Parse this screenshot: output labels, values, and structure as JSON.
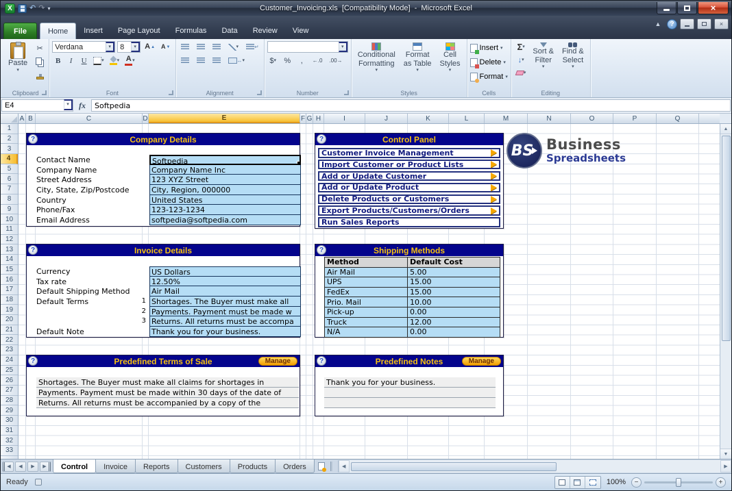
{
  "titlebar": {
    "title": "Customer_Invoicing.xls  [Compatibility Mode]  -  Microsoft Excel"
  },
  "icons": {
    "excel": "X",
    "undo": "↶",
    "redo": "↷",
    "caret": "▾",
    "help": "?",
    "close": "×",
    "up": "▲",
    "down": "▼",
    "left": "◀",
    "right": "▶",
    "grow": "▲",
    "shrink": "▼",
    "wrap_return": "↵",
    "merge_arrows": "↔",
    "fill_arrow": "↓"
  },
  "ribbon_tabs": {
    "file": "File",
    "tabs": [
      "Home",
      "Insert",
      "Page Layout",
      "Formulas",
      "Data",
      "Review",
      "View"
    ],
    "active": "Home"
  },
  "ribbon": {
    "clipboard": {
      "label": "Clipboard",
      "paste": "Paste",
      "cut": "✂"
    },
    "font": {
      "label": "Font",
      "name": "Verdana",
      "size": "8",
      "bold": "B",
      "italic": "I",
      "underline": "U",
      "letter": "A"
    },
    "alignment": {
      "label": "Alignment"
    },
    "number": {
      "label": "Number",
      "format": "",
      "currency": "$",
      "percent": "%",
      "comma": ",",
      "inc_dec": "←.0",
      "dec_dec": ".00→"
    },
    "styles": {
      "label": "Styles",
      "cond1": "Conditional",
      "cond2": "Formatting",
      "tbl1": "Format",
      "tbl2": "as Table",
      "cs1": "Cell",
      "cs2": "Styles"
    },
    "cells": {
      "label": "Cells",
      "insert": "Insert",
      "del": "Delete",
      "format": "Format"
    },
    "editing": {
      "label": "Editing",
      "autosum": "Σ",
      "sf1": "Sort &",
      "sf2": "Filter",
      "fs1": "Find &",
      "fs2": "Select"
    }
  },
  "formula_bar": {
    "name_box": "E4",
    "fx": "fx",
    "value": "Softpedia"
  },
  "grid": {
    "columns": [
      "A",
      "B",
      "C",
      "D",
      "E",
      "F",
      "G",
      "H",
      "I",
      "J",
      "K",
      "L",
      "M",
      "N",
      "O",
      "P",
      "Q"
    ],
    "selected_column": "E",
    "row_count": 33,
    "selected_row": 4
  },
  "panels": {
    "company": {
      "title": "Company Details",
      "fields": [
        {
          "label": "Contact Name",
          "value": "Softpedia",
          "selected": true
        },
        {
          "label": "Company Name",
          "value": "Company Name Inc"
        },
        {
          "label": "Street Address",
          "value": "123 XYZ Street"
        },
        {
          "label": "City, State, Zip/Postcode",
          "value": "City, Region, 000000"
        },
        {
          "label": "Country",
          "value": "United States"
        },
        {
          "label": "Phone/Fax",
          "value": "123-123-1234"
        },
        {
          "label": "Email Address",
          "value": "softpedia@softpedia.com"
        }
      ]
    },
    "control": {
      "title": "Control Panel",
      "buttons": [
        {
          "label": "Customer Invoice Management",
          "arrow": true
        },
        {
          "label": "Import Customer or Product Lists",
          "arrow": true
        },
        {
          "label": "Add or Update Customer",
          "arrow": true
        },
        {
          "label": "Add or Update Product",
          "arrow": true
        },
        {
          "label": "Delete Products or Customers",
          "arrow": true
        },
        {
          "label": "Export Products/Customers/Orders",
          "arrow": true
        },
        {
          "label": "Run Sales Reports",
          "arrow": false
        }
      ]
    },
    "invoice": {
      "title": "Invoice Details",
      "rows": [
        {
          "label": "Currency",
          "value": "US Dollars"
        },
        {
          "label": "Tax rate",
          "value": "12.50%"
        },
        {
          "label": "Default Shipping Method",
          "value": "Air Mail"
        },
        {
          "label": "Default Terms",
          "num": "1",
          "value": "Shortages. The Buyer must make all"
        },
        {
          "label": "",
          "num": "2",
          "value": "Payments. Payment must be made w"
        },
        {
          "label": "",
          "num": "3",
          "value": "Returns. All returns must be accompa"
        },
        {
          "label": "Default Note",
          "value": "Thank you for your business."
        }
      ]
    },
    "shipping": {
      "title": "Shipping Methods",
      "col1": "Method",
      "col2": "Default Cost",
      "rows": [
        [
          "Air Mail",
          "5.00"
        ],
        [
          "UPS",
          "15.00"
        ],
        [
          "FedEx",
          "15.00"
        ],
        [
          "Prio. Mail",
          "10.00"
        ],
        [
          "Pick-up",
          "0.00"
        ],
        [
          "Truck",
          "12.00"
        ],
        [
          "N/A",
          "0.00"
        ]
      ]
    },
    "terms": {
      "title": "Predefined Terms of Sale",
      "manage": "Manage",
      "lines": [
        "Shortages. The Buyer must make all claims for shortages in",
        "Payments. Payment must be made within 30 days of the date of",
        "Returns. All returns must be accompanied by a copy of the"
      ]
    },
    "notes": {
      "title": "Predefined Notes",
      "manage": "Manage",
      "lines": [
        "Thank you for your business.",
        "",
        ""
      ]
    }
  },
  "logo": {
    "initials": "BS",
    "line1": "Business",
    "line2": "Spreadsheets"
  },
  "sheet_tabs": {
    "tabs": [
      "Control",
      "Invoice",
      "Reports",
      "Customers",
      "Products",
      "Orders"
    ],
    "active": "Control"
  },
  "status_bar": {
    "mode": "Ready",
    "zoom": "100%",
    "zoom_out": "−",
    "zoom_in": "+"
  }
}
